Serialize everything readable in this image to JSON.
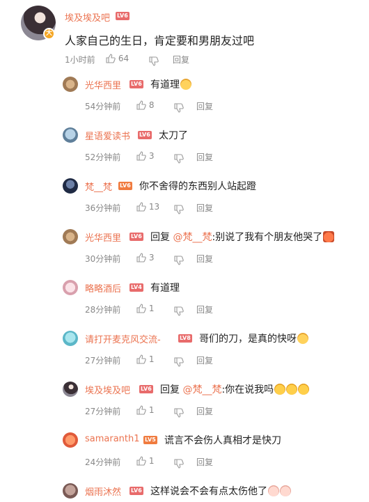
{
  "main_comment": {
    "username": "埃及埃及吧",
    "level": "LV6",
    "content": "人家自己的生日，肯定要和男朋友过吧",
    "time": "1小时前",
    "likes": "64",
    "reply_label": "回复",
    "verified_icon": "v-badge-icon"
  },
  "replies": [
    {
      "username": "光华西里",
      "level": "LV6",
      "content": "有道理",
      "emoji": "cat-emoji-icon",
      "time": "54分钟前",
      "likes": "8",
      "reply_label": "回复"
    },
    {
      "username": "星语爱读书",
      "level": "LV6",
      "content": "太刀了",
      "time": "52分钟前",
      "likes": "3",
      "reply_label": "回复"
    },
    {
      "username": "梵__梵",
      "level": "LV6",
      "content": "你不舍得的东西别人站起蹬",
      "time": "36分钟前",
      "likes": "13",
      "reply_label": "回复"
    },
    {
      "username": "光华西里",
      "level": "LV6",
      "content_prefix": "回复 ",
      "mention": "@梵__梵",
      "content": ":别说了我有个朋友他哭了",
      "emoji": "angry-emoji-icon",
      "time": "30分钟前",
      "likes": "3",
      "reply_label": "回复"
    },
    {
      "username": "略略酒后",
      "level": "LV4",
      "content": "有道理",
      "time": "28分钟前",
      "likes": "1",
      "reply_label": "回复"
    },
    {
      "username": "请打开麦克风交流-",
      "level": "LV8",
      "content": "哥们的刀，是真的快呀",
      "emoji": "cat-emoji-icon",
      "time": "27分钟前",
      "likes": "1",
      "reply_label": "回复"
    },
    {
      "username": "埃及埃及吧",
      "level": "LV6",
      "content_prefix": "回复 ",
      "mention": "@梵__梵",
      "content": ":你在说我吗",
      "emoji": "cry-emoji-icon",
      "time": "27分钟前",
      "likes": "1",
      "reply_label": "回复"
    },
    {
      "username": "samaranth1",
      "level": "LV5",
      "content": "谎言不会伤人真相才是快刀",
      "time": "24分钟前",
      "likes": "1",
      "reply_label": "回复"
    },
    {
      "username": "烟雨沐然",
      "level": "LV6",
      "content": "这样说会不会有点太伤他了",
      "emoji": "pig-emoji-icon",
      "time": "",
      "likes": "",
      "reply_label": ""
    }
  ]
}
